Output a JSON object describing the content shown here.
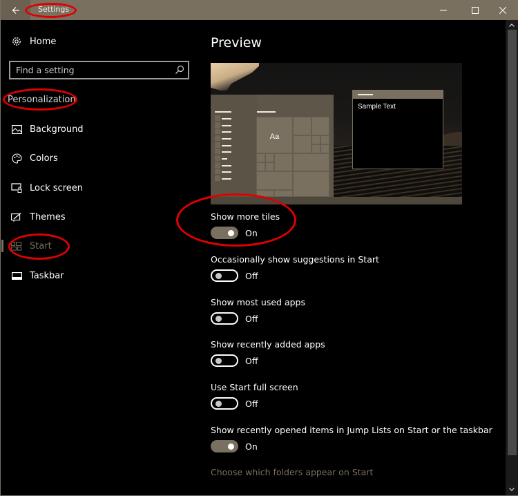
{
  "window": {
    "title": "Settings",
    "controls": {
      "minimize": "minimize",
      "maximize": "maximize",
      "close": "close"
    }
  },
  "sidebar": {
    "home_label": "Home",
    "search_placeholder": "Find a setting",
    "section_title": "Personalization",
    "items": [
      {
        "label": "Background",
        "icon": "picture-icon",
        "active": false
      },
      {
        "label": "Colors",
        "icon": "palette-icon",
        "active": false
      },
      {
        "label": "Lock screen",
        "icon": "lock-screen-icon",
        "active": false
      },
      {
        "label": "Themes",
        "icon": "themes-icon",
        "active": false
      },
      {
        "label": "Start",
        "icon": "start-icon",
        "active": true
      },
      {
        "label": "Taskbar",
        "icon": "taskbar-icon",
        "active": false
      }
    ]
  },
  "main": {
    "title": "Preview",
    "preview": {
      "tile_label": "Aa",
      "sample_text": "Sample Text"
    },
    "settings": [
      {
        "label": "Show more tiles",
        "state": "On",
        "on": true
      },
      {
        "label": "Occasionally show suggestions in Start",
        "state": "Off",
        "on": false
      },
      {
        "label": "Show most used apps",
        "state": "Off",
        "on": false
      },
      {
        "label": "Show recently added apps",
        "state": "Off",
        "on": false
      },
      {
        "label": "Use Start full screen",
        "state": "Off",
        "on": false
      },
      {
        "label": "Show recently opened items in Jump Lists on Start or the taskbar",
        "state": "On",
        "on": true
      }
    ],
    "link": "Choose which folders appear on Start"
  },
  "colors": {
    "accent": "#7a7060",
    "annotation": "#e00000",
    "background": "#000000"
  }
}
